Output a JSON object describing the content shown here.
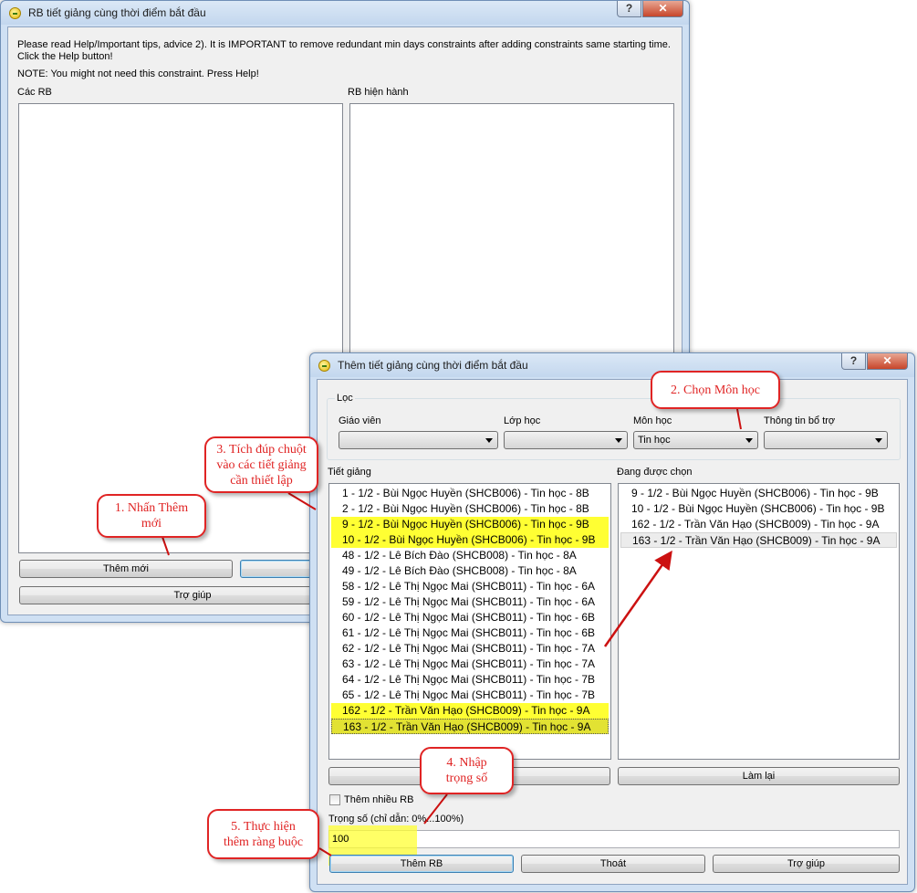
{
  "main_window": {
    "title": "RB tiết giảng cùng thời điểm bắt đầu",
    "help_button": "?",
    "close_button": "✕",
    "advice_line1": "Please read Help/Important tips, advice 2). It is IMPORTANT to remove redundant min days constraints after adding constraints same starting time.",
    "advice_line2": "Click the Help button!",
    "note": "NOTE: You might not need this constraint. Press Help!",
    "list_all_label": "Các RB",
    "list_current_label": "RB hiện hành",
    "add_button": "Thêm mới",
    "help_wide_button": "Trợ giúp"
  },
  "dialog": {
    "title": "Thêm tiết giảng cùng thời điểm bắt đầu",
    "help_button": "?",
    "close_button": "✕",
    "filter_group": "Lọc",
    "filters": {
      "teacher_label": "Giáo viên",
      "teacher_value": "",
      "class_label": "Lớp học",
      "class_value": "",
      "subject_label": "Môn học",
      "subject_value": "Tin học",
      "extra_label": "Thông tin bổ trợ",
      "extra_value": ""
    },
    "activities_label": "Tiết giảng",
    "activities": [
      "1 - 1/2 - Bùi Ngọc Huyền (SHCB006) - Tin học - 8B",
      "2 - 1/2 - Bùi Ngọc Huyền (SHCB006) - Tin học - 8B",
      "9 - 1/2 - Bùi Ngọc Huyền (SHCB006) - Tin học - 9B",
      "10 - 1/2 - Bùi Ngọc Huyền (SHCB006) - Tin học - 9B",
      "48 - 1/2 - Lê Bích  Đào (SHCB008) - Tin học - 8A",
      "49 - 1/2 - Lê Bích  Đào (SHCB008) - Tin học - 8A",
      "58 - 1/2 - Lê Thị Ngọc Mai (SHCB011) - Tin học - 6A",
      "59 - 1/2 - Lê Thị Ngọc Mai (SHCB011) - Tin học - 6A",
      "60 - 1/2 - Lê Thị Ngọc Mai (SHCB011) - Tin học - 6B",
      "61 - 1/2 - Lê Thị Ngọc Mai (SHCB011) - Tin học - 6B",
      "62 - 1/2 - Lê Thị Ngọc Mai (SHCB011) - Tin học - 7A",
      "63 - 1/2 - Lê Thị Ngọc Mai (SHCB011) - Tin học - 7A",
      "64 - 1/2 - Lê Thị Ngọc Mai (SHCB011) - Tin học - 7B",
      "65 - 1/2 - Lê Thị Ngọc Mai (SHCB011) - Tin học - 7B",
      "162 - 1/2 - Trần Văn Hạo (SHCB009) - Tin học - 9A",
      "163 - 1/2 - Trần Văn Hạo (SHCB009) - Tin học - 9A"
    ],
    "selected_label": "Đang được chọn",
    "selected": [
      "9 - 1/2 - Bùi Ngọc Huyền (SHCB006) - Tin học - 9B",
      "10 - 1/2 - Bùi Ngọc Huyền (SHCB006) - Tin học - 9B",
      "162 - 1/2 - Trần Văn Hạo (SHCB009) - Tin học - 9A",
      "163 - 1/2 - Trần Văn Hạo (SHCB009) - Tin học - 9A"
    ],
    "reset_button": "Làm lại",
    "multi_checkbox_label": "Thêm nhiều RB",
    "weight_label": "Trọng số (chỉ dẫn: 0%...100%)",
    "weight_value": "100",
    "add_button": "Thêm RB",
    "exit_button": "Thoát",
    "help_button_bottom": "Trợ giúp"
  },
  "callouts": {
    "c1": [
      "1. Nhấn Thêm",
      "mới"
    ],
    "c2": [
      "2. Chọn Môn học"
    ],
    "c3": [
      "3. Tích đúp chuột",
      "vào các tiết giảng",
      "cần thiết lập"
    ],
    "c4": [
      "4. Nhập",
      "trọng số"
    ],
    "c5": [
      "5. Thực hiện",
      "thêm ràng buộc"
    ]
  },
  "colors": {
    "highlight": "#ffff33",
    "callout_border": "#e02424",
    "arrow": "#cc1111"
  }
}
